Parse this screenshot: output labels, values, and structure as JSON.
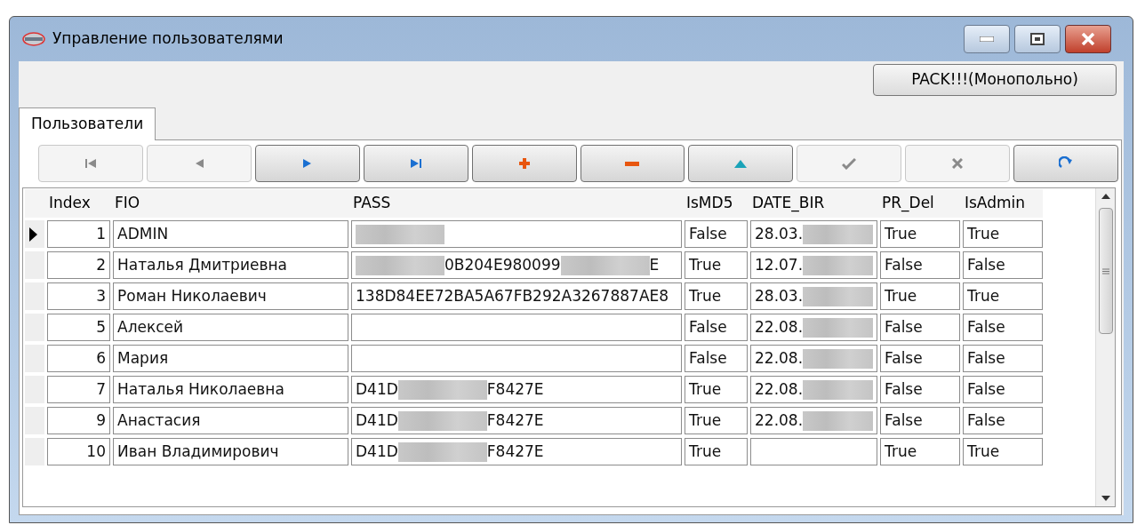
{
  "window": {
    "title": "Управление пользователями"
  },
  "pack_button": "PACK!!!(Монопольно)",
  "tabs": [
    {
      "label": "Пользователи",
      "selected": true
    }
  ],
  "navigator": [
    {
      "kind": "first",
      "disabled": true
    },
    {
      "kind": "prior",
      "disabled": true
    },
    {
      "kind": "next",
      "disabled": false
    },
    {
      "kind": "last",
      "disabled": false
    },
    {
      "kind": "insert",
      "disabled": false
    },
    {
      "kind": "delete",
      "disabled": false
    },
    {
      "kind": "edit",
      "disabled": false
    },
    {
      "kind": "post",
      "disabled": true
    },
    {
      "kind": "cancel",
      "disabled": true
    },
    {
      "kind": "refresh",
      "disabled": false
    }
  ],
  "table": {
    "columns": [
      "Index",
      "FIO",
      "PASS",
      "IsMD5",
      "DATE_BIR",
      "PR_Del",
      "IsAdmin"
    ],
    "rows": [
      {
        "current": true,
        "index": "1",
        "fio": "ADMIN",
        "pass": [
          {
            "kind": "redacted"
          }
        ],
        "is_md5": "False",
        "date_bir": [
          {
            "kind": "text",
            "text": "28.03."
          },
          {
            "kind": "redacted"
          }
        ],
        "pr_del": "True",
        "is_admin": "True"
      },
      {
        "current": false,
        "index": "2",
        "fio": "Наталья Дмитриевна",
        "pass": [
          {
            "kind": "redacted"
          },
          {
            "kind": "text",
            "text": "0B204E980099"
          },
          {
            "kind": "redacted"
          },
          {
            "kind": "text",
            "text": "E"
          }
        ],
        "is_md5": "True",
        "date_bir": [
          {
            "kind": "text",
            "text": "12.07."
          },
          {
            "kind": "redacted"
          }
        ],
        "pr_del": "False",
        "is_admin": "False"
      },
      {
        "current": false,
        "index": "3",
        "fio": "Роман Николаевич",
        "pass": [
          {
            "kind": "text",
            "text": "138D84EE72BA5A67FB292A3267887AE8"
          }
        ],
        "is_md5": "True",
        "date_bir": [
          {
            "kind": "text",
            "text": "28.03."
          },
          {
            "kind": "redacted"
          }
        ],
        "pr_del": "True",
        "is_admin": "True"
      },
      {
        "current": false,
        "index": "5",
        "fio": "Алексей",
        "pass": [],
        "is_md5": "False",
        "date_bir": [
          {
            "kind": "text",
            "text": "22.08."
          },
          {
            "kind": "redacted"
          }
        ],
        "pr_del": "False",
        "is_admin": "False"
      },
      {
        "current": false,
        "index": "6",
        "fio": "Мария",
        "pass": [],
        "is_md5": "False",
        "date_bir": [
          {
            "kind": "text",
            "text": "22.08."
          },
          {
            "kind": "redacted"
          }
        ],
        "pr_del": "False",
        "is_admin": "False"
      },
      {
        "current": false,
        "index": "7",
        "fio": "Наталья Николаевна",
        "pass": [
          {
            "kind": "text",
            "text": "D41D"
          },
          {
            "kind": "redacted"
          },
          {
            "kind": "text",
            "text": "F8427E"
          }
        ],
        "is_md5": "True",
        "date_bir": [
          {
            "kind": "text",
            "text": "22.08."
          },
          {
            "kind": "redacted"
          }
        ],
        "pr_del": "False",
        "is_admin": "False"
      },
      {
        "current": false,
        "index": "9",
        "fio": "Анастасия",
        "pass": [
          {
            "kind": "text",
            "text": "D41D"
          },
          {
            "kind": "redacted"
          },
          {
            "kind": "text",
            "text": "F8427E"
          }
        ],
        "is_md5": "True",
        "date_bir": [
          {
            "kind": "text",
            "text": "22.08."
          },
          {
            "kind": "redacted"
          }
        ],
        "pr_del": "False",
        "is_admin": "False"
      },
      {
        "current": false,
        "index": "10",
        "fio": "Иван Владимирович",
        "pass": [
          {
            "kind": "text",
            "text": "D41D"
          },
          {
            "kind": "redacted"
          },
          {
            "kind": "text",
            "text": "F8427E"
          }
        ],
        "is_md5": "True",
        "date_bir": [],
        "pr_del": "True",
        "is_admin": "True"
      }
    ]
  }
}
